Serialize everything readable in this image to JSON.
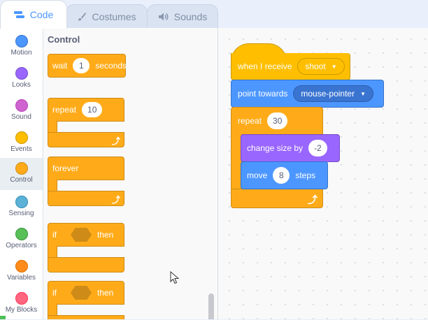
{
  "tabs": [
    {
      "label": "Code",
      "icon": "code-icon"
    },
    {
      "label": "Costumes",
      "icon": "brush-icon"
    },
    {
      "label": "Sounds",
      "icon": "speaker-icon"
    }
  ],
  "categories": [
    {
      "label": "Motion",
      "color": "#4c97ff"
    },
    {
      "label": "Looks",
      "color": "#9966ff"
    },
    {
      "label": "Sound",
      "color": "#cf63cf"
    },
    {
      "label": "Events",
      "color": "#ffbf00"
    },
    {
      "label": "Control",
      "color": "#ffab19"
    },
    {
      "label": "Sensing",
      "color": "#5cb1d6"
    },
    {
      "label": "Operators",
      "color": "#59c059"
    },
    {
      "label": "Variables",
      "color": "#ff8c1a"
    },
    {
      "label": "My Blocks",
      "color": "#ff6680"
    }
  ],
  "palette": {
    "title": "Control",
    "wait": {
      "label": "wait",
      "value": "1",
      "suffix": "seconds"
    },
    "repeat": {
      "label": "repeat",
      "value": "10"
    },
    "forever": {
      "label": "forever"
    },
    "if_then_1": {
      "if": "if",
      "then": "then"
    },
    "if_then_2": {
      "if": "if",
      "then": "then"
    }
  },
  "script": {
    "hat": {
      "label": "when I receive",
      "message": "shoot"
    },
    "point": {
      "label": "point towards",
      "target": "mouse-pointer"
    },
    "repeat": {
      "label": "repeat",
      "value": "30"
    },
    "change_size": {
      "label": "change size by",
      "value": "-2"
    },
    "move": {
      "label": "move",
      "value": "8",
      "suffix": "steps"
    }
  }
}
